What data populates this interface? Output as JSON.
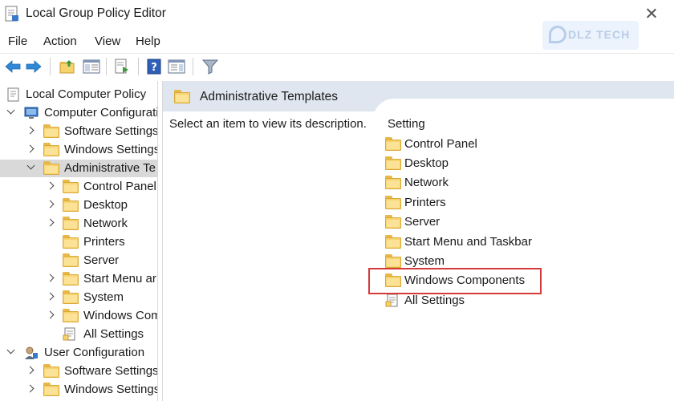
{
  "window": {
    "title": "Local Group Policy Editor"
  },
  "watermark": {
    "text": "DLZ TECH"
  },
  "menu": {
    "items": [
      "File",
      "Action",
      "View",
      "Help"
    ]
  },
  "toolbar": {
    "buttons": [
      "back-arrow-icon",
      "forward-arrow-icon",
      "up-folder-icon",
      "show-hide-tree-icon",
      "export-list-icon",
      "help-icon",
      "properties-pane-icon",
      "filter-icon"
    ]
  },
  "tree": {
    "root": "Local Computer Policy",
    "computer_config": "Computer Configurati",
    "cc_software": "Software Settings",
    "cc_windows": "Windows Settings",
    "cc_admin": "Administrative Te",
    "admin_children": [
      "Control Panel",
      "Desktop",
      "Network",
      "Printers",
      "Server",
      "Start Menu ar",
      "System",
      "Windows Com",
      "All Settings"
    ],
    "user_config": "User Configuration",
    "uc_software": "Software Settings",
    "uc_windows": "Windows Settings"
  },
  "right_pane": {
    "header_title": "Administrative Templates",
    "description": "Select an item to view its description.",
    "column_header": "Setting",
    "items": [
      "Control Panel",
      "Desktop",
      "Network",
      "Printers",
      "Server",
      "Start Menu and Taskbar",
      "System",
      "Windows Components",
      "All Settings"
    ]
  },
  "colors": {
    "folder": "#f6d36d",
    "highlight": "#d63a3a",
    "header_band": "#dfe6ef",
    "selected_row": "#d9d9d9"
  }
}
